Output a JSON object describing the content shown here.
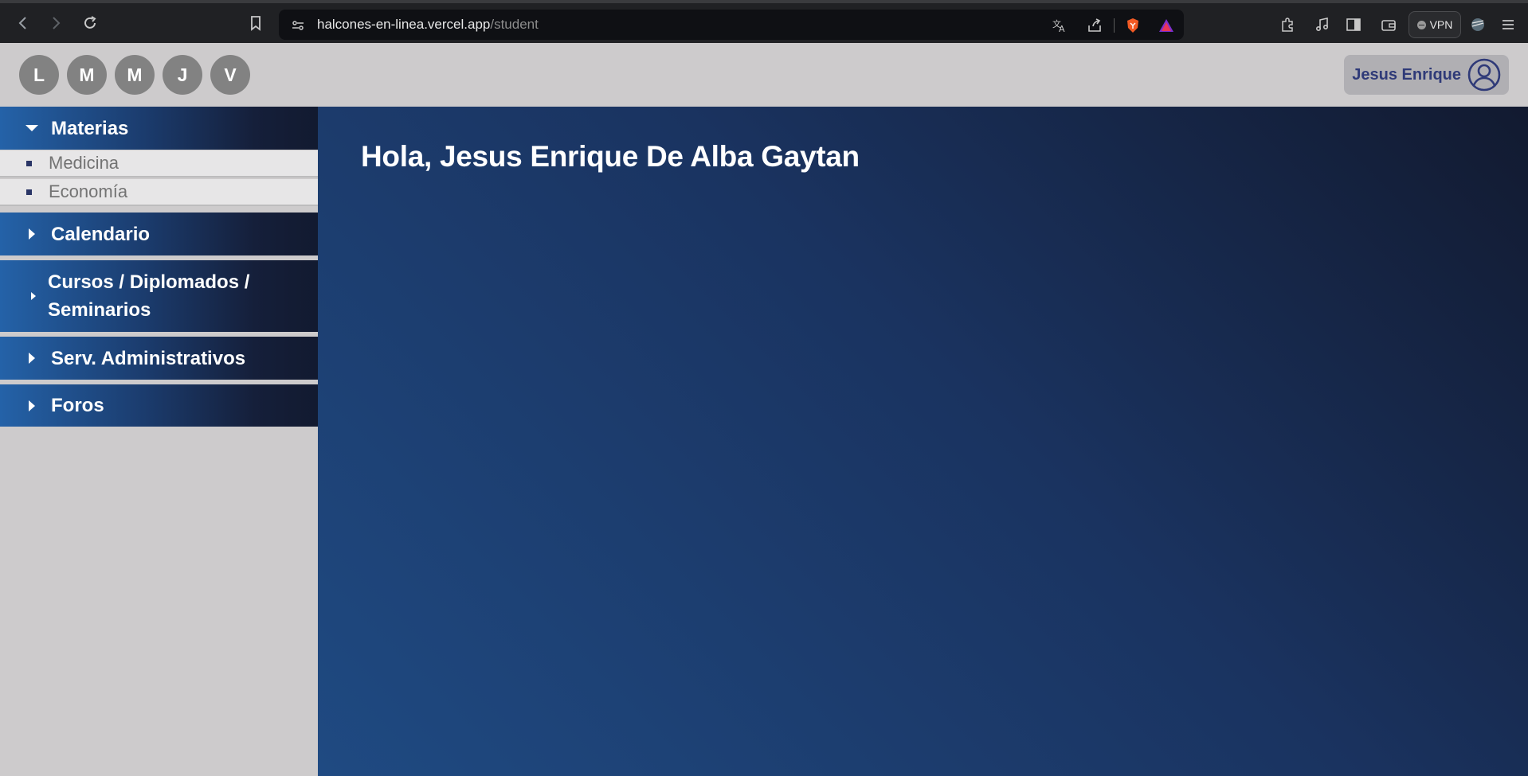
{
  "browser": {
    "url_host": "halcones-en-linea.vercel.app",
    "url_path": "/student",
    "vpn_label": "VPN",
    "icons": [
      "back-icon",
      "forward-icon",
      "reload-icon",
      "bookmark-icon",
      "site-settings-icon",
      "translate-icon",
      "share-icon",
      "brave-shields-icon",
      "brave-rewards-icon",
      "extensions-icon",
      "media-icon",
      "sidebar-icon",
      "wallet-icon",
      "vpn-icon",
      "profile-icon",
      "menu-icon"
    ]
  },
  "header": {
    "days": [
      "L",
      "M",
      "M",
      "J",
      "V"
    ],
    "user_name": "Jesus Enrique",
    "user_icon": "user-circle-icon"
  },
  "sidebar": {
    "materias": {
      "label": "Materias",
      "items": [
        "Medicina",
        "Economía"
      ]
    },
    "items": [
      {
        "label": "Calendario"
      },
      {
        "label": "Cursos / Diplomados / Seminarios",
        "line1": "Cursos / Diplomados /",
        "line2": "Seminarios"
      },
      {
        "label": "Serv. Administrativos"
      },
      {
        "label": "Foros"
      }
    ]
  },
  "main": {
    "greeting": "Hola, Jesus Enrique De Alba Gaytan"
  },
  "colors": {
    "header_bg": "#cdcbcc",
    "sidebar_gradient_start": "#2462a8",
    "sidebar_gradient_end": "#121a30",
    "main_bg": "#1a3360",
    "user_text": "#2f3a78",
    "day_circle": "#828282"
  }
}
